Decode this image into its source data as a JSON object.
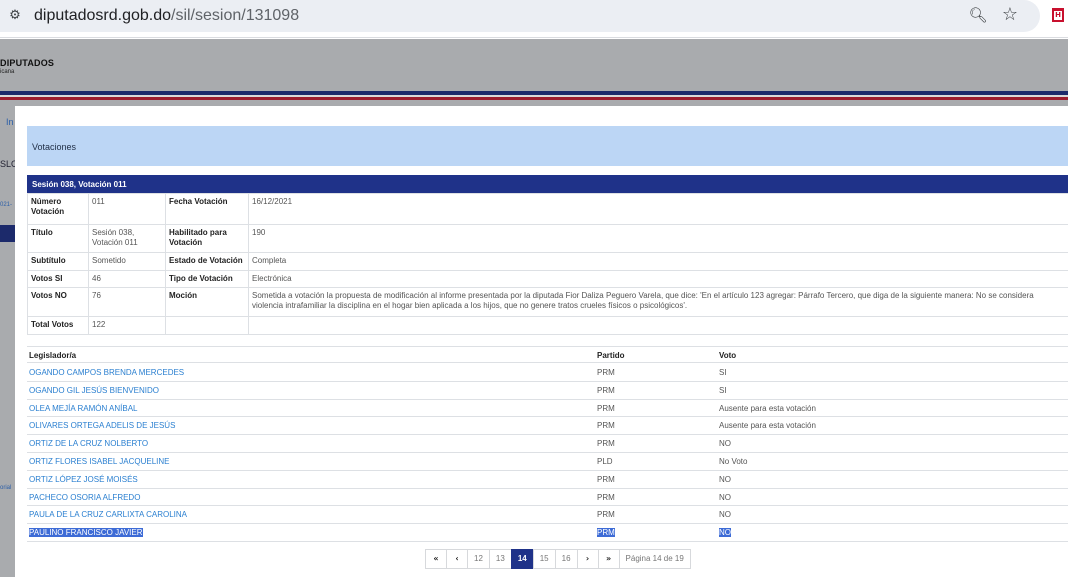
{
  "browser": {
    "url_domain": "diputadosrd.gob.do",
    "url_path": "/sil/sesion/131098",
    "site_info_icon": "tune-icon",
    "zoom_icon": "zoom-icon",
    "star_icon": "star-icon",
    "extension_icon": "shield-extension-icon"
  },
  "background": {
    "logo_text": "DIPUTADOS",
    "logo_sub": "icana",
    "partial_in": "In",
    "partial_slo": "SLO",
    "partial_date": "021-",
    "partial_orial": "orial"
  },
  "modal": {
    "title": "Votaciones",
    "session_heading": "Sesión 038, Votación 011",
    "details": {
      "numero_label": "Número Votación",
      "numero_value": "011",
      "fecha_label": "Fecha Votación",
      "fecha_value": "16/12/2021",
      "titulo_label": "Título",
      "titulo_value": "Sesión 038, Votación 011",
      "habilitado_label": "Habilitado para Votación",
      "habilitado_value": "190",
      "subtitulo_label": "Subtítulo",
      "subtitulo_value": "Sometido",
      "estado_label": "Estado de Votación",
      "estado_value": "Completa",
      "si_label": "Votos SI",
      "si_value": "46",
      "tipo_label": "Tipo de Votación",
      "tipo_value": "Electrónica",
      "no_label": "Votos NO",
      "no_value": "76",
      "mocion_label": "Moción",
      "mocion_value": "Sometida a votación la propuesta de modificación al informe presentada por la diputada Fior Daliza Peguero Varela, que dice: 'En el artículo 123 agregar: Párrafo Tercero, que diga de la siguiente manera: No se considera violencia intrafamiliar la disciplina en el hogar bien aplicada a los hijos, que no genere tratos crueles físicos o psicológicos'.",
      "total_label": "Total Votos",
      "total_value": "122"
    },
    "votes_table": {
      "col_legislator": "Legislador/a",
      "col_party": "Partido",
      "col_vote": "Voto",
      "rows": [
        {
          "name": "OGANDO CAMPOS BRENDA MERCEDES",
          "party": "PRM",
          "vote": "SI"
        },
        {
          "name": "OGANDO GIL JESÚS BIENVENIDO",
          "party": "PRM",
          "vote": "SI"
        },
        {
          "name": "OLEA MEJÍA RAMÓN ANÍBAL",
          "party": "PRM",
          "vote": "Ausente para esta votación"
        },
        {
          "name": "OLIVARES ORTEGA ADELIS DE JESÚS",
          "party": "PRM",
          "vote": "Ausente para esta votación"
        },
        {
          "name": "ORTIZ DE LA CRUZ NOLBERTO",
          "party": "PRM",
          "vote": "NO"
        },
        {
          "name": "ORTIZ FLORES ISABEL JACQUELINE",
          "party": "PLD",
          "vote": "No Voto"
        },
        {
          "name": "ORTIZ LÓPEZ JOSÉ MOISÉS",
          "party": "PRM",
          "vote": "NO"
        },
        {
          "name": "PACHECO OSORIA ALFREDO",
          "party": "PRM",
          "vote": "NO"
        },
        {
          "name": "PAULA DE LA CRUZ CARLIXTA CAROLINA",
          "party": "PRM",
          "vote": "NO"
        },
        {
          "name": "PAULINO FRANCISCO JAVIER",
          "party": "PRM",
          "vote": "NO",
          "selected": true
        }
      ]
    },
    "pagination": {
      "first": "«",
      "prev": "‹",
      "pages": [
        "12",
        "13",
        "14",
        "15",
        "16"
      ],
      "current": "14",
      "next": "›",
      "last": "»",
      "info": "Página 14 de 19"
    }
  }
}
